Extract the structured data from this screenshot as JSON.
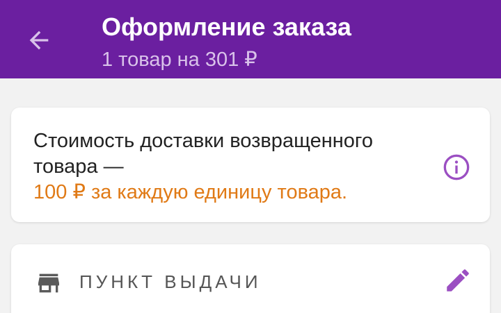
{
  "header": {
    "title": "Оформление заказа",
    "subtitle": "1 товар на 301 ₽",
    "back_icon": "arrow-back-icon",
    "background_color": "#6b1fa0"
  },
  "delivery_notice": {
    "line1": "Стоимость доставки возвращенного",
    "line2": "товара —",
    "highlight": "100 ₽ за каждую единицу товара.",
    "highlight_color": "#e07a16",
    "info_icon": "info-icon"
  },
  "pickup": {
    "label": "ПУНКТ ВЫДАЧИ",
    "icon": "store-icon",
    "edit_icon": "edit-pencil-icon"
  },
  "colors": {
    "accent": "#9b4fc2",
    "page_background": "#f2f2f2"
  }
}
